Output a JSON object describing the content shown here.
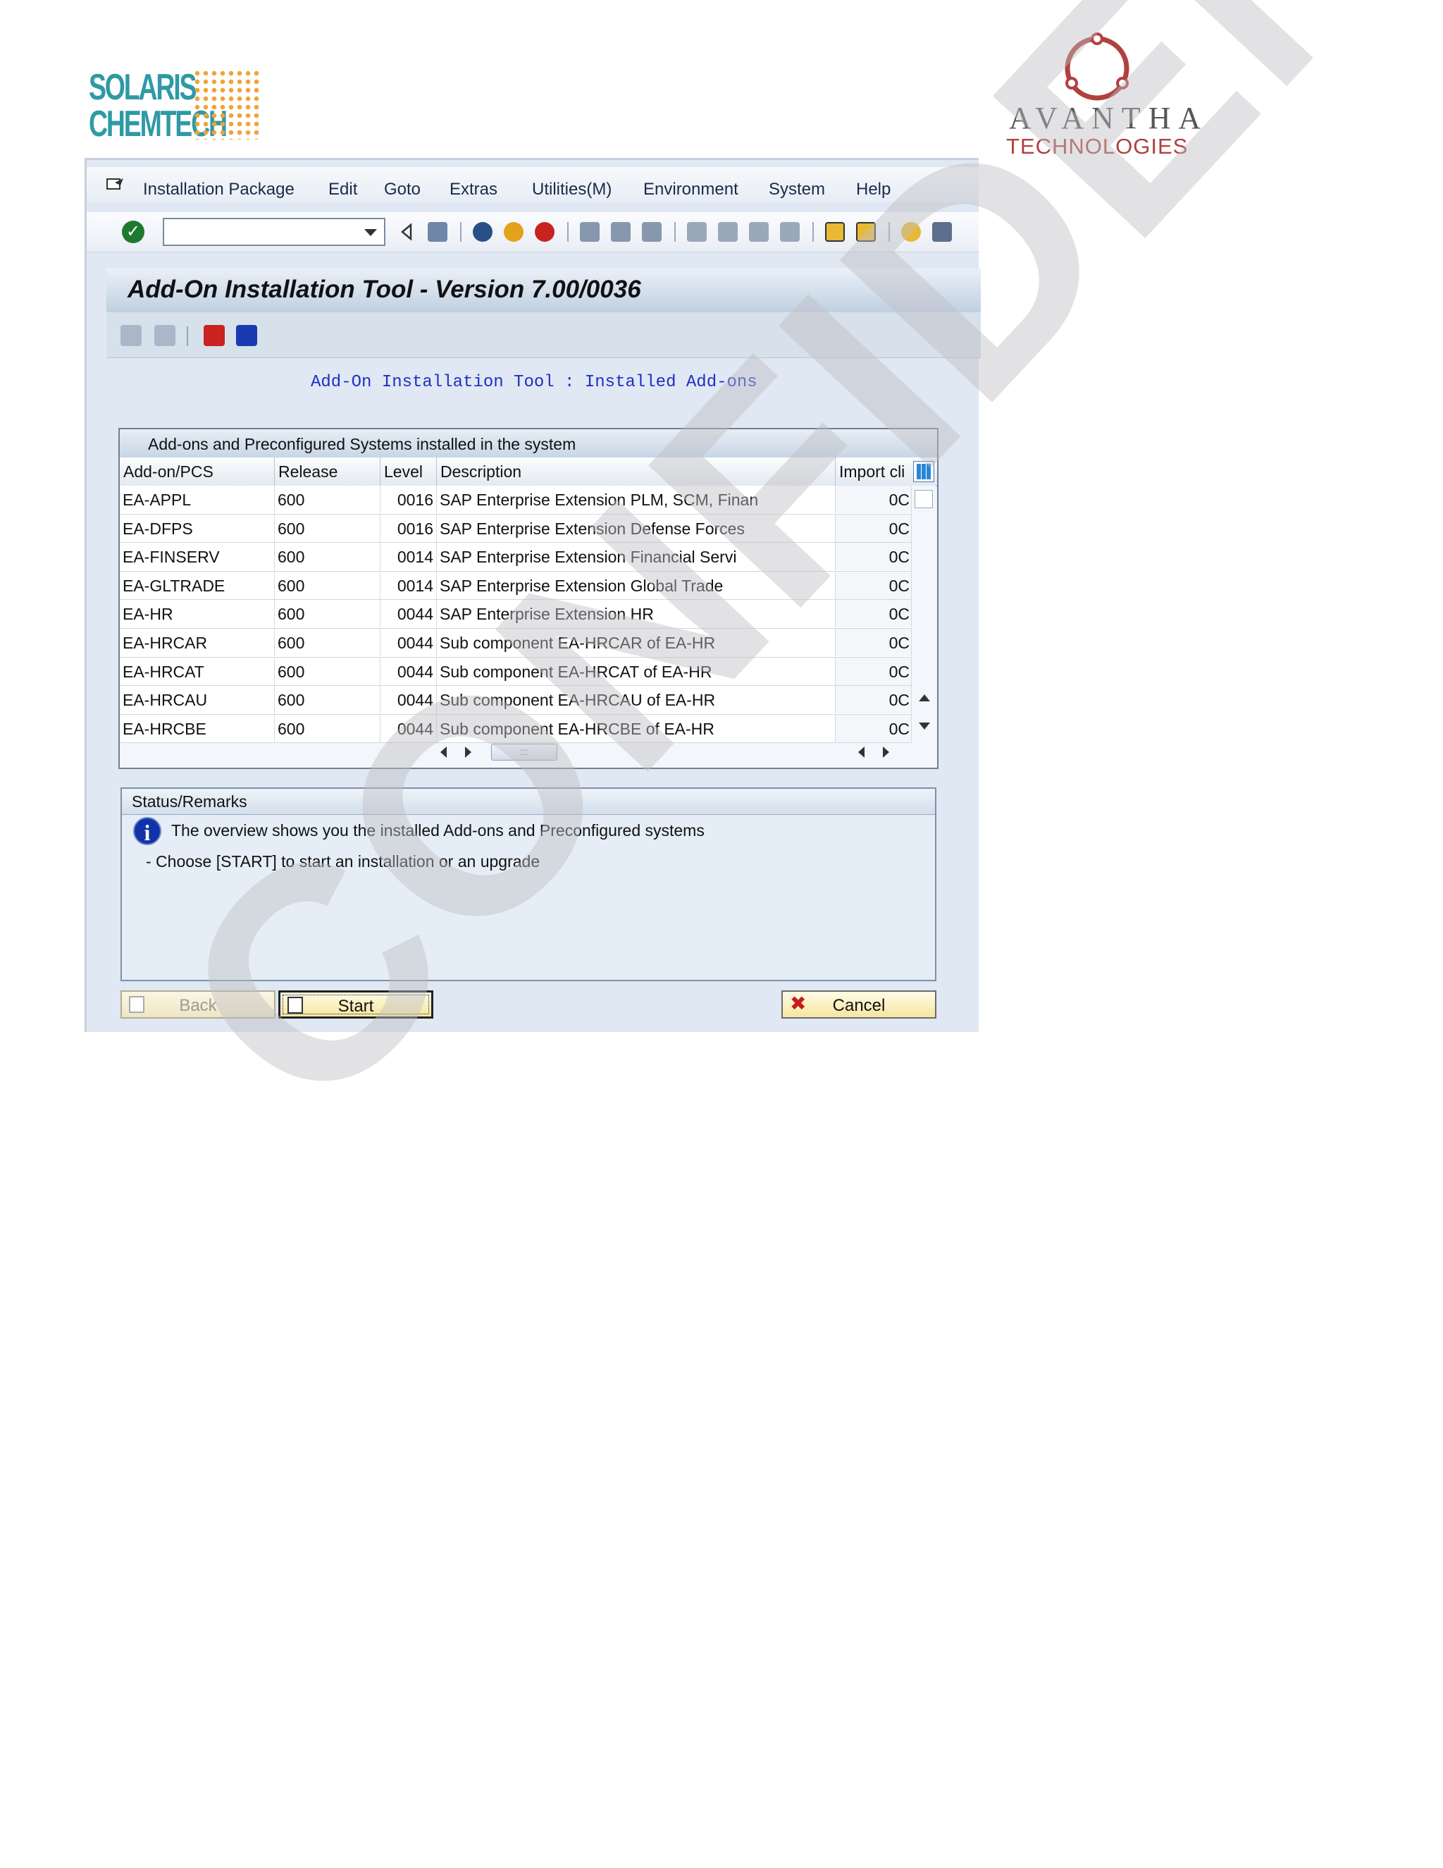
{
  "logos": {
    "solaris_line1": "SOLARIS",
    "solaris_line2": "CHEMTECH",
    "avantha_name": "AVANTHA",
    "avantha_sub": "TECHNOLOGIES"
  },
  "menu": [
    "Installation Package",
    "Edit",
    "Goto",
    "Extras",
    "Utilities(M)",
    "Environment",
    "System",
    "Help"
  ],
  "command_field": {
    "value": ""
  },
  "window_title": "Add-On Installation Tool - Version 7.00/0036",
  "subtitle": "Add-On Installation Tool : Installed Add-ons",
  "table": {
    "caption": "Add-ons and Preconfigured Systems installed in the system",
    "columns": [
      "Add-on/PCS",
      "Release",
      "Level",
      "Description",
      "Import cli"
    ],
    "rows": [
      [
        "EA-APPL",
        "600",
        "0016",
        "SAP Enterprise Extension PLM, SCM, Finan",
        "0C"
      ],
      [
        "EA-DFPS",
        "600",
        "0016",
        "SAP Enterprise Extension Defense Forces",
        "0C"
      ],
      [
        "EA-FINSERV",
        "600",
        "0014",
        "SAP Enterprise Extension Financial Servi",
        "0C"
      ],
      [
        "EA-GLTRADE",
        "600",
        "0014",
        "SAP Enterprise Extension Global Trade",
        "0C"
      ],
      [
        "EA-HR",
        "600",
        "0044",
        "SAP Enterprise Extension HR",
        "0C"
      ],
      [
        "EA-HRCAR",
        "600",
        "0044",
        "Sub component EA-HRCAR of EA-HR",
        "0C"
      ],
      [
        "EA-HRCAT",
        "600",
        "0044",
        "Sub component EA-HRCAT of EA-HR",
        "0C"
      ],
      [
        "EA-HRCAU",
        "600",
        "0044",
        "Sub component EA-HRCAU of EA-HR",
        "0C"
      ],
      [
        "EA-HRCBE",
        "600",
        "0044",
        "Sub component EA-HRCBE of EA-HR",
        "0C"
      ]
    ]
  },
  "status": {
    "title": "Status/Remarks",
    "line1": "The overview shows you the installed Add-ons and Preconfigured systems",
    "line2": "- Choose [START] to start an installation or an upgrade"
  },
  "buttons": {
    "back": "Back",
    "start": "Start",
    "cancel": "Cancel"
  },
  "watermark": "CONFIDENTIAL",
  "colors": {
    "title_bar": "#bfd0e2",
    "link_blue": "#2030c0",
    "button_yellow": "#f6e6a0",
    "cancel_red": "#c81b1b"
  }
}
